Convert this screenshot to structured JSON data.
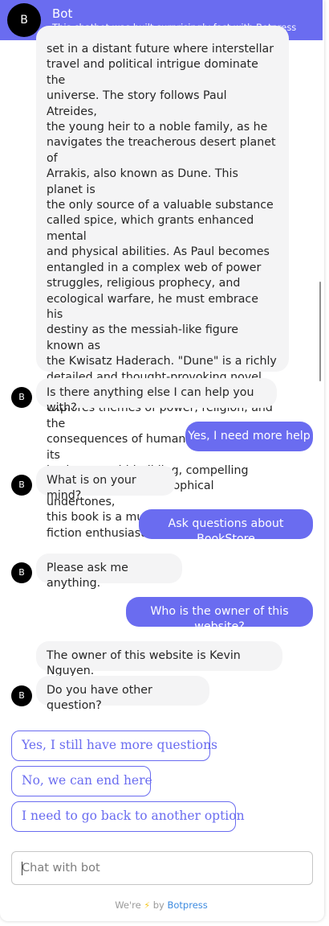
{
  "header": {
    "avatar_letter": "B",
    "title": "Bot",
    "subtitle": "This chatbot was built surprisingly fast with Botpress"
  },
  "messages": [
    {
      "from": "bot",
      "avatar": "",
      "lines": [
        "set in a distant future where interstellar",
        "travel and political intrigue dominate the",
        "universe. The story follows Paul Atreides,",
        "the young heir to a noble family, as he",
        "navigates the treacherous desert planet of",
        "Arrakis, also known as Dune. This planet is",
        "the only source of a valuable substance",
        "called spice, which grants enhanced mental",
        "and physical abilities. As Paul becomes",
        "entangled in a complex web of power",
        "struggles, religious prophecy, and",
        "ecological warfare, he must embrace his",
        "destiny as the messiah-like figure known as",
        "the Kwisatz Haderach. \"Dune\" is a richly",
        "detailed and thought-provoking novel that",
        "explores themes of power, religion, and the",
        "consequences of human ambition. With its",
        "intricate world-building, compelling",
        "characters, and philosophical undertones,",
        "this book is a must-read for any science",
        "fiction enthusiast."
      ]
    },
    {
      "from": "bot",
      "avatar": "B",
      "text": "Is there anything else I can help you with?"
    },
    {
      "from": "user",
      "text": "Yes, I need more help"
    },
    {
      "from": "bot",
      "avatar": "B",
      "text": "What is on your mind?"
    },
    {
      "from": "user",
      "text": "Ask questions about BookStore"
    },
    {
      "from": "bot",
      "avatar": "B",
      "text": "Please ask me anything."
    },
    {
      "from": "user",
      "text": "Who is the owner of this website?"
    },
    {
      "from": "bot",
      "avatar": "",
      "text": "The owner of this website is Kevin Nguyen."
    },
    {
      "from": "bot",
      "avatar": "B",
      "text": "Do you have other question?"
    }
  ],
  "choices": [
    "Yes, I still have more questions",
    "No, we can end here",
    "I need to go back to another option"
  ],
  "composer": {
    "placeholder": "Chat with bot",
    "value": ""
  },
  "footer": {
    "prefix": "We're",
    "icon": "bolt-icon",
    "middle": "by",
    "brand": "Botpress"
  },
  "colors": {
    "accent": "#6a6cf0",
    "bot_bubble": "#f4f4f5",
    "avatar": "#000000",
    "footer_link": "#3d8be0",
    "bolt": "#f5c518"
  }
}
